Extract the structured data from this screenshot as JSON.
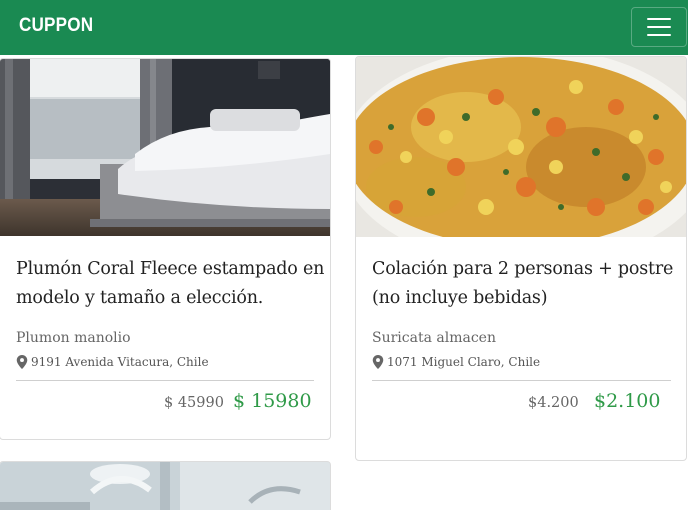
{
  "navbar": {
    "brand": "CUPPON",
    "brand_color": "#1a8a52",
    "toggler_icon": "hamburger-menu-icon"
  },
  "deals": [
    {
      "title_line1": "Plumón Coral Fleece estampado en",
      "title_line2": "modelo y tamaño a elección.",
      "vendor": "Plumon manolio",
      "address": "9191 Avenida Vitacura, Chile",
      "old_price": "$ 45990",
      "new_price": "$ 15980",
      "image": "bedroom-bed-photo"
    },
    {
      "title_line1": "Colación para 2 personas + postre",
      "title_line2": "(no incluye bebidas)",
      "vendor": "Suricata almacen",
      "address": "1071 Miguel Claro, Chile",
      "old_price": "$4.200",
      "new_price": "$2.100",
      "image": "vegetable-dish-photo"
    },
    {
      "image": "dental-clinic-photo"
    }
  ],
  "colors": {
    "new_price": "#2f9a48",
    "old_price": "#666666"
  },
  "icons": {
    "location": "map-pin-icon"
  }
}
